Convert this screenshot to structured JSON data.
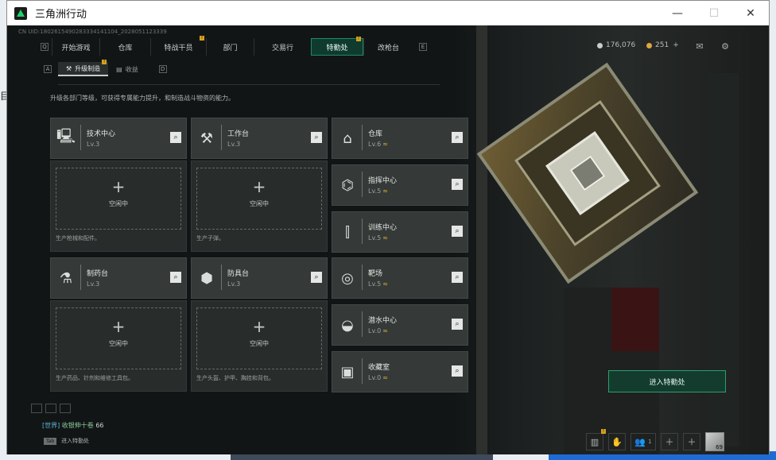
{
  "window": {
    "title": "三角洲行动",
    "controls": {
      "minimize": "—",
      "maximize": "☐",
      "close": "✕"
    }
  },
  "uid": "CN UID:1802615490283334141104_2028051123339",
  "topnav": {
    "key_left": "Q",
    "key_right": "E",
    "tabs": [
      {
        "label": "开始游戏",
        "badge": ""
      },
      {
        "label": "仓库",
        "badge": ""
      },
      {
        "label": "特战干员",
        "badge": "!"
      },
      {
        "label": "部门",
        "badge": ""
      },
      {
        "label": "交易行",
        "badge": ""
      },
      {
        "label": "特勤处",
        "badge": "!",
        "active": true
      },
      {
        "label": "改枪台",
        "badge": ""
      }
    ]
  },
  "currency": {
    "coins": "176,076",
    "premium": "251",
    "premium_plus": "+"
  },
  "subnav": {
    "key_left": "A",
    "key_right": "D",
    "tabs": [
      {
        "label": "升级制造",
        "badge": "!",
        "active": true
      },
      {
        "label": "收益",
        "badge": ""
      }
    ]
  },
  "description": "升级各部门等级，可获得专属能力提升，和制造战斗物资的能力。",
  "facilities": [
    {
      "name": "技术中心",
      "level": "Lv.3",
      "upgrade": false,
      "icon": "computer-icon",
      "slot": {
        "plus": "+",
        "status": "空闲中",
        "produces": "生产枪械和配件。"
      }
    },
    {
      "name": "工作台",
      "level": "Lv.3",
      "upgrade": false,
      "icon": "tools-icon",
      "slot": {
        "plus": "+",
        "status": "空闲中",
        "produces": "生产子弹。"
      }
    },
    {
      "name": "制药台",
      "level": "Lv.3",
      "upgrade": false,
      "icon": "pharmacy-icon",
      "slot": {
        "plus": "+",
        "status": "空闲中",
        "produces": "生产药品、针剂和维修工具包。"
      }
    },
    {
      "name": "防具台",
      "level": "Lv.3",
      "upgrade": false,
      "icon": "armor-icon",
      "slot": {
        "plus": "+",
        "status": "空闲中",
        "produces": "生产头盔、护甲、胸挂和背包。"
      }
    }
  ],
  "side_facilities": [
    {
      "name": "仓库",
      "level": "Lv.6",
      "upgrade": "≈",
      "icon": "warehouse-icon"
    },
    {
      "name": "指挥中心",
      "level": "Lv.5",
      "upgrade": "≈",
      "icon": "chip-icon"
    },
    {
      "name": "训练中心",
      "level": "Lv.5",
      "upgrade": "≈",
      "icon": "dumbbell-icon"
    },
    {
      "name": "靶场",
      "level": "Lv.5",
      "upgrade": "≈",
      "icon": "target-icon"
    },
    {
      "name": "潜水中心",
      "level": "Lv.0",
      "upgrade": "≈",
      "icon": "diving-mask-icon"
    },
    {
      "name": "收藏室",
      "level": "Lv.0",
      "upgrade": "≈",
      "icon": "vault-icon"
    }
  ],
  "enter_button": "进入特勤处",
  "chat": {
    "channel": "[世界]",
    "sender": "收银伸十卷",
    "emote": "66"
  },
  "tabhint": {
    "key": "Tab",
    "label": "进入特勤处"
  },
  "bottom": {
    "friends_count": "1",
    "avatar_level": "69",
    "badge": "!"
  }
}
